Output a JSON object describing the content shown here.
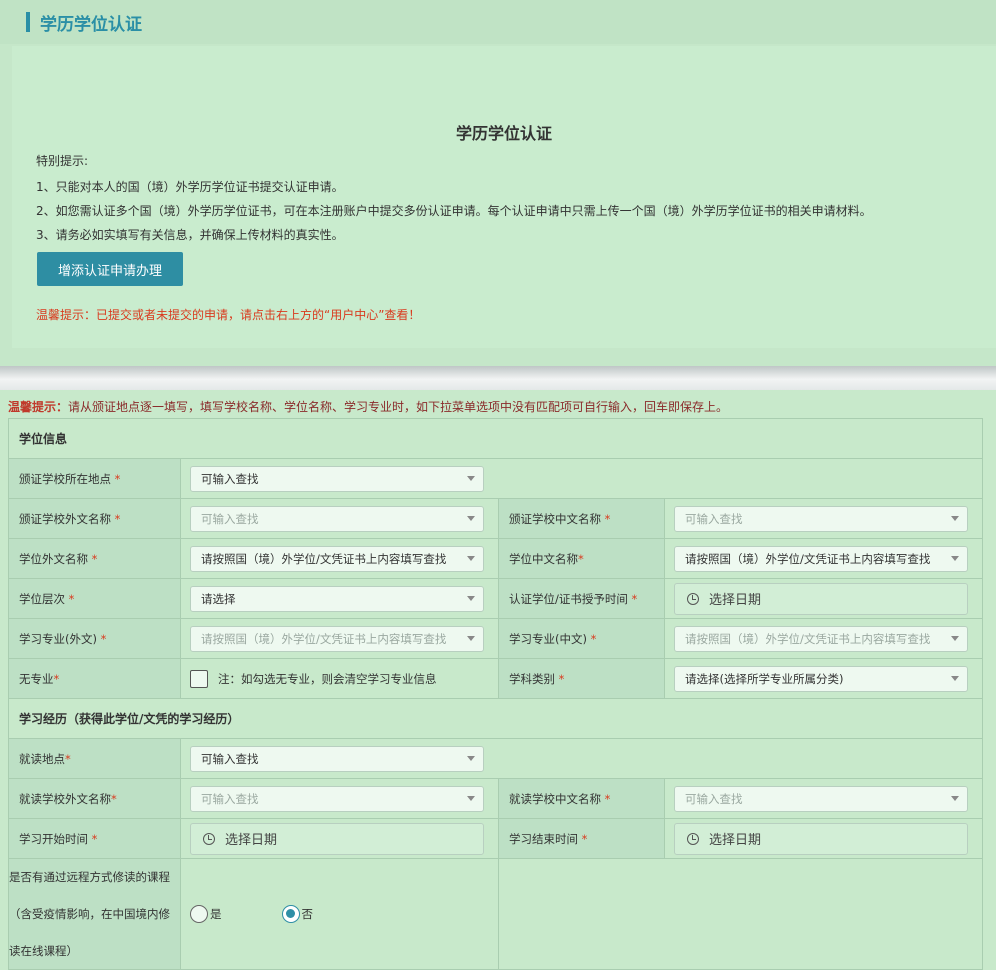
{
  "header": {
    "title": "学历学位认证"
  },
  "card": {
    "title": "学历学位认证",
    "notice_label": "特别提示:",
    "notice_1": "1、只能对本人的国（境）外学历学位证书提交认证申请。",
    "notice_2": "2、如您需认证多个国（境）外学历学位证书，可在本注册账户中提交多份认证申请。每个认证申请中只需上传一个国（境）外学历学位证书的相关申请材料。",
    "notice_3": "3、请务必如实填写有关信息，并确保上传材料的真实性。",
    "add_button": "增添认证申请办理",
    "warm_tip": "温馨提示：已提交或者未提交的申请，请点击右上方的“用户中心”查看！"
  },
  "form_note": {
    "prefix": "温馨提示：",
    "text": "请从颁证地点逐一填写，填写学校名称、学位名称、学习专业时，如下拉菜单选项中没有匹配项可自行输入，回车即保存上。"
  },
  "degree_section": {
    "title": "学位信息"
  },
  "fields": {
    "school_location": {
      "label": "颁证学校所在地点",
      "star": "*",
      "value": "可输入查找"
    },
    "school_foreign_name": {
      "label": "颁证学校外文名称",
      "star": "*",
      "placeholder": "可输入查找"
    },
    "school_cn_name": {
      "label": "颁证学校中文名称",
      "star": "*",
      "placeholder": "可输入查找"
    },
    "degree_foreign_name": {
      "label": "学位外文名称",
      "star": "*",
      "value": "请按照国（境）外学位/文凭证书上内容填写查找"
    },
    "degree_cn_name": {
      "label": "学位中文名称",
      "star": "*",
      "value": "请按照国（境）外学位/文凭证书上内容填写查找"
    },
    "degree_level": {
      "label": "学位层次",
      "star": "*",
      "value": "请选择"
    },
    "award_date": {
      "label": "认证学位/证书授予时间",
      "star": "*",
      "value": "选择日期"
    },
    "major_foreign": {
      "label": "学习专业(外文)",
      "star": "*",
      "placeholder": "请按照国（境）外学位/文凭证书上内容填写查找"
    },
    "major_cn": {
      "label": "学习专业(中文)",
      "star": "*",
      "placeholder": "请按照国（境）外学位/文凭证书上内容填写查找"
    },
    "no_major": {
      "label": "无专业",
      "star": "*",
      "note": "注：如勾选无专业，则会清空学习专业信息"
    },
    "subject_category": {
      "label": "学科类别",
      "star": "*",
      "value": "请选择(选择所学专业所属分类)"
    }
  },
  "study_section": {
    "title": "学习经历（获得此学位/文凭的学习经历）"
  },
  "study": {
    "location": {
      "label": "就读地点",
      "star": "*",
      "value": "可输入查找"
    },
    "school_foreign_name": {
      "label": "就读学校外文名称",
      "star": "*",
      "placeholder": "可输入查找"
    },
    "school_cn_name": {
      "label": "就读学校中文名称",
      "star": "*",
      "placeholder": "可输入查找"
    },
    "start_date": {
      "label": "学习开始时间",
      "star": "*",
      "value": "选择日期"
    },
    "end_date": {
      "label": "学习结束时间",
      "star": "*",
      "value": "选择日期"
    },
    "remote": {
      "label_1": "是否有通过远程方式修读的课程",
      "label_2": "（含受疫情影响，在中国境内修",
      "label_3": "读在线课程）",
      "yes": "是",
      "no": "否",
      "selected": "否"
    }
  },
  "colors": {
    "accent": "#2a8fa6",
    "warning": "#d93a1e",
    "background": "#c8e9cb"
  }
}
